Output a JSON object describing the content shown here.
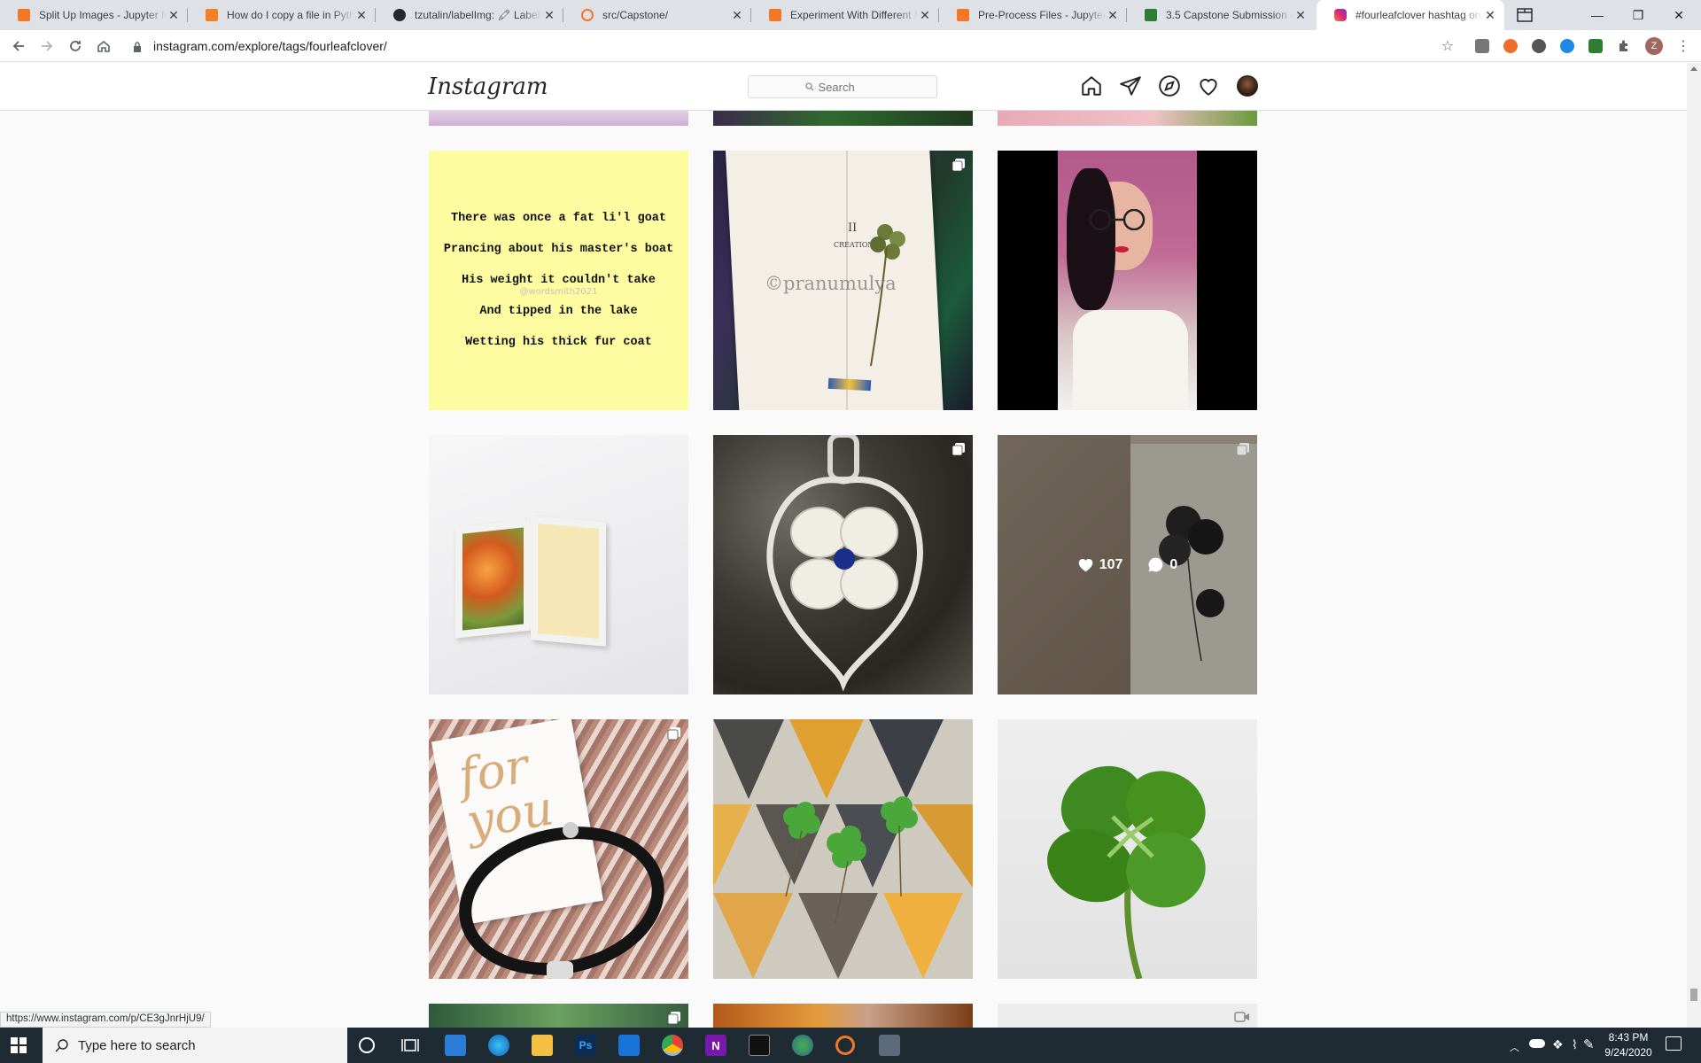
{
  "browser": {
    "tabs": [
      {
        "title": "Split Up Images - Jupyter N",
        "favicon_color": "#f37726"
      },
      {
        "title": "How do I copy a file in Pyth",
        "favicon_color": "#f48024"
      },
      {
        "title": "tzutalin/labelImg: 🖍 Label",
        "favicon_color": "#24292e"
      },
      {
        "title": "src/Capstone/",
        "favicon_color": "#f37726"
      },
      {
        "title": "Experiment With Different M",
        "favicon_color": "#f37726"
      },
      {
        "title": "Pre-Process Files - Jupyter N",
        "favicon_color": "#f37726"
      },
      {
        "title": "3.5 Capstone Submission - S",
        "favicon_color": "#2e7d32"
      },
      {
        "title": "#fourleafclover hashtag on",
        "favicon_color": "#c13584"
      }
    ],
    "url": "instagram.com/explore/tags/fourleafclover/",
    "profile_initial": "Z",
    "status_url": "https://www.instagram.com/p/CE3gJnrHjU9/"
  },
  "instagram": {
    "logo": "Instagram",
    "search_placeholder": "Search",
    "nav_icons": [
      "home-icon",
      "direct-icon",
      "explore-icon",
      "activity-icon",
      "profile-avatar"
    ],
    "poem_lines": [
      "There was once a fat li'l goat",
      "Prancing about his master's boat",
      "His weight it couldn't take",
      "And tipped in the lake",
      "Wetting his thick fur coat"
    ],
    "poem_watermark": "@wordsmith2021",
    "book_watermark": "©pranumulya",
    "book_chapter": "II",
    "book_heading": "CREATION",
    "card_text": "for you",
    "hovered_post": {
      "likes": "107",
      "comments": "0"
    }
  },
  "taskbar": {
    "search_placeholder": "Type here to search",
    "time": "8:43 PM",
    "date": "9/24/2020"
  }
}
